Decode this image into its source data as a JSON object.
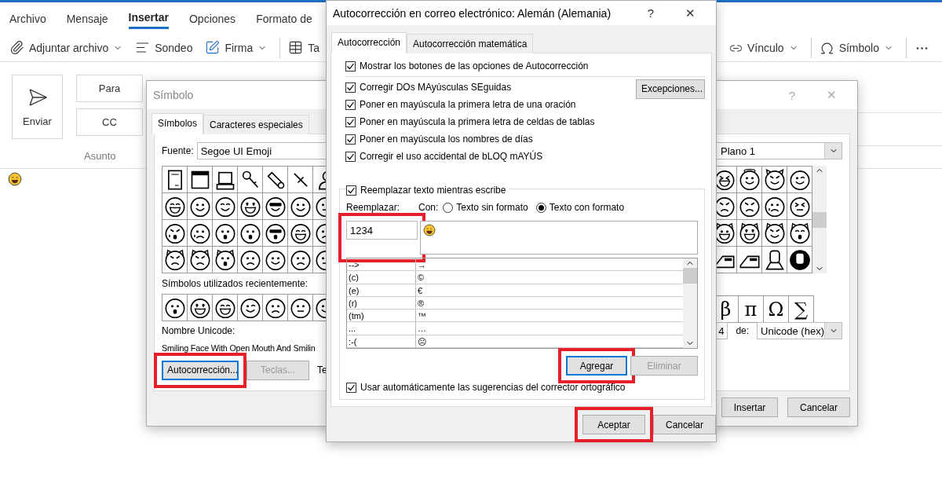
{
  "ribbon": {
    "tabs": [
      {
        "label": "Archivo",
        "selected": false
      },
      {
        "label": "Mensaje",
        "selected": false
      },
      {
        "label": "Insertar",
        "selected": true
      },
      {
        "label": "Opciones",
        "selected": false
      },
      {
        "label": "Formato de",
        "selected": false
      }
    ],
    "toolbar_left": [
      {
        "kind": "attach",
        "label": "Adjuntar archivo",
        "dropdown": true
      },
      {
        "kind": "poll",
        "label": "Sondeo",
        "dropdown": false
      },
      {
        "kind": "signature",
        "label": "Firma",
        "dropdown": true
      },
      {
        "kind": "table",
        "label": "Ta"
      }
    ],
    "toolbar_right": [
      {
        "kind": "link",
        "label": "Vínculo",
        "dropdown": true
      },
      {
        "kind": "symbol",
        "label": "Símbolo",
        "dropdown": true
      },
      {
        "kind": "more"
      }
    ]
  },
  "compose": {
    "send": "Enviar",
    "to": "Para",
    "cc": "CC",
    "subject": "Asunto"
  },
  "symbol_dialog": {
    "title": "Símbolo",
    "title_buttons": [
      "?",
      "✕"
    ],
    "tabs": [
      {
        "label": "Símbolos",
        "selected": true
      },
      {
        "label": "Caracteres especiales",
        "selected": false
      }
    ],
    "font_label": "Fuente:",
    "font_value": "Segoe UI Emoji",
    "subset_value": "Plano 1",
    "recent_label": "Símbolos utilizados recientemente:",
    "recent_symbols": [
      "β",
      "π",
      "Ω",
      "∑"
    ],
    "unicode_name_label": "Nombre Unicode:",
    "unicode_name": "Smiling Face With Open Mouth And Smilin",
    "buttons": [
      {
        "label": "Autocorrección...",
        "disabled": false,
        "highlighted": true
      },
      {
        "label": "Teclas...",
        "disabled": true,
        "highlighted": false
      }
    ],
    "shortcut_label": "Te",
    "char_code": "4",
    "from_label": "de:",
    "from_value": "Unicode (hex)",
    "footer_buttons": [
      "Insertar",
      "Cancelar"
    ]
  },
  "autocorrect_dialog": {
    "title": "Autocorrección en correo electrónico: Alemán (Alemania)",
    "title_buttons": [
      "?",
      "✕"
    ],
    "tabs": [
      {
        "label": "Autocorrección",
        "selected": true
      },
      {
        "label": "Autocorrección matemática",
        "selected": false
      }
    ],
    "options": [
      {
        "label": "Mostrar los botones de las opciones de Autocorrección",
        "checked": true
      },
      {
        "label": "Corregir DOs MAyúsculas SEguidas",
        "checked": true
      },
      {
        "label": "Poner en mayúscula la primera letra de una oración",
        "checked": true
      },
      {
        "label": "Poner en mayúscula la primera letra de celdas de tablas",
        "checked": true
      },
      {
        "label": "Poner en mayúscula los nombres de días",
        "checked": true
      },
      {
        "label": "Corregir el uso accidental de bLOQ mAYÚS",
        "checked": true
      }
    ],
    "exceptions_button": "Excepciones...",
    "replace_option": {
      "label": "Reemplazar texto mientras escribe",
      "checked": true
    },
    "replace_label": "Reemplazar:",
    "with_label": "Con:",
    "format_options": [
      {
        "label": "Texto sin formato",
        "selected": false
      },
      {
        "label": "Texto con formato",
        "selected": true
      }
    ],
    "replace_value": "1234",
    "replace_highlighted": true,
    "entries": [
      {
        "replace": "-->",
        "with": "→"
      },
      {
        "replace": "(c)",
        "with": "©"
      },
      {
        "replace": "(e)",
        "with": "€"
      },
      {
        "replace": "(r)",
        "with": "®"
      },
      {
        "replace": "(tm)",
        "with": "™"
      },
      {
        "replace": "...",
        "with": "…"
      },
      {
        "replace": ":-(",
        "with": "☹"
      }
    ],
    "action_buttons": [
      {
        "label": "Agregar",
        "disabled": false,
        "focused": true,
        "highlighted": true
      },
      {
        "label": "Eliminar",
        "disabled": true,
        "focused": false,
        "highlighted": false
      }
    ],
    "suggestions_option": {
      "label": "Usar automáticamente las sugerencias del corrector ortográfico",
      "checked": true
    },
    "footer_buttons": [
      {
        "label": "Aceptar",
        "highlighted": true
      },
      {
        "label": "Cancelar",
        "highlighted": false
      }
    ]
  }
}
